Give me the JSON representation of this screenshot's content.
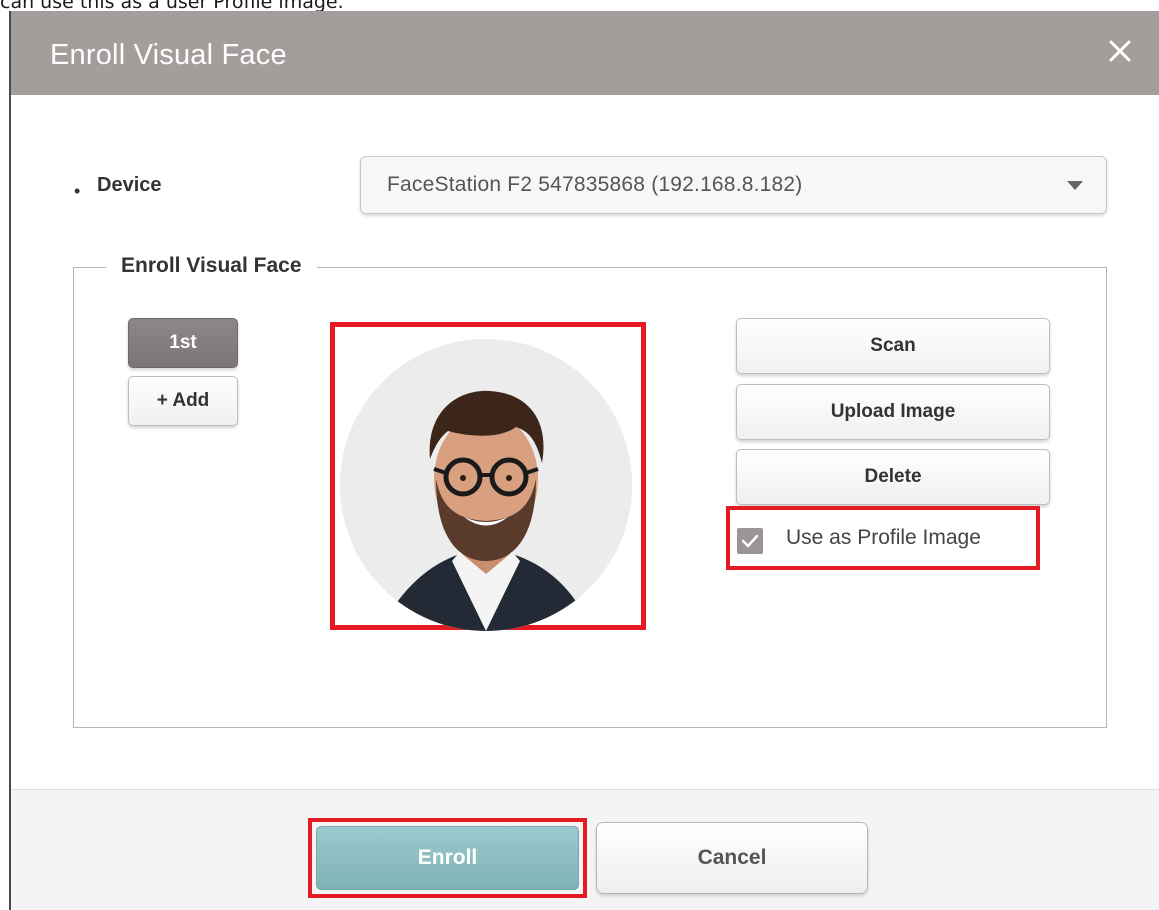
{
  "caption": "can use this as a user Profile image.",
  "dialog": {
    "title": "Enroll Visual Face",
    "close_icon": "close-icon"
  },
  "device": {
    "label": "Device",
    "selected": "FaceStation F2 547835868 (192.168.8.182)"
  },
  "enroll_section": {
    "legend": "Enroll Visual Face",
    "slots": [
      {
        "label": "1st"
      },
      {
        "label": "+ Add"
      }
    ],
    "actions": {
      "scan": "Scan",
      "upload": "Upload Image",
      "delete": "Delete"
    },
    "profile_checkbox": {
      "label": "Use as Profile Image",
      "checked": true
    }
  },
  "footer": {
    "enroll": "Enroll",
    "cancel": "Cancel"
  },
  "colors": {
    "title_bar": "#a39d9b",
    "highlight": "#e41b23",
    "enroll_button": "#8dbfc2",
    "selected_slot": "#7f7a7a"
  }
}
